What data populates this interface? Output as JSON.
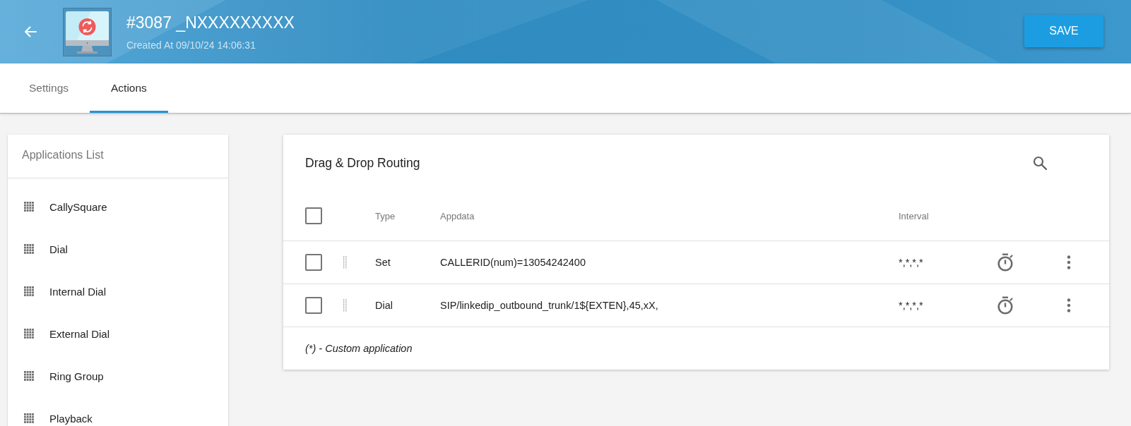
{
  "header": {
    "title": "#3087 _NXXXXXXXXX",
    "subtitle": "Created At 09/10/24 14:06:31",
    "save_label": "SAVE"
  },
  "tabs": [
    {
      "label": "Settings",
      "selected": false
    },
    {
      "label": "Actions",
      "selected": true
    }
  ],
  "applications": {
    "title": "Applications List",
    "items": [
      "CallySquare",
      "Dial",
      "Internal Dial",
      "External Dial",
      "Ring Group",
      "Playback"
    ]
  },
  "routing": {
    "title": "Drag & Drop Routing",
    "select_all_checked": false,
    "columns": [
      "Type",
      "Appdata",
      "Interval"
    ],
    "rows": [
      {
        "checked": false,
        "type": "Set",
        "appdata": "CALLERID(num)=13054242400",
        "interval": "*,*,*,*"
      },
      {
        "checked": false,
        "type": "Dial",
        "appdata": "SIP/linkedip_outbound_trunk/1${EXTEN},45,xX,",
        "interval": "*,*,*,*"
      }
    ],
    "footnote": "(*) - Custom application"
  }
}
